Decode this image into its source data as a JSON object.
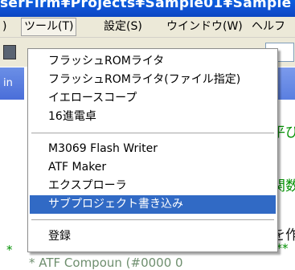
{
  "window": {
    "title_fragment": "serFirm¥Projects¥Sample01¥Sample"
  },
  "menubar": {
    "items": [
      {
        "label": ")"
      },
      {
        "label": "ツール(T)"
      },
      {
        "label": "設定(S)"
      },
      {
        "label": "ウインドウ(W)"
      },
      {
        "label": "ヘルフ"
      }
    ]
  },
  "left_tab": {
    "label": "in"
  },
  "background": {
    "frag_a": "平び",
    "frag_b": "関数",
    "frag_c": "を作",
    "frag_d": "***",
    "frag_bottom": "* ATF Compoun (#0000 0",
    "frag_bottom_left": "*"
  },
  "tools_menu": {
    "items": [
      {
        "label": "フラッシュROMライタ"
      },
      {
        "label": "フラッシュROMライタ(ファイル指定)"
      },
      {
        "label": "イエロースコープ"
      },
      {
        "label": "16進電卓"
      },
      {
        "label": "M3069 Flash Writer"
      },
      {
        "label": "ATF Maker"
      },
      {
        "label": "エクスプローラ"
      },
      {
        "label": "サブプロジェクト書き込み",
        "highlighted": true
      },
      {
        "label": "登録"
      }
    ]
  },
  "colors": {
    "highlight": "#316ac5",
    "titlebar": "#0a5fe0",
    "menubar": "#ece9d8"
  }
}
